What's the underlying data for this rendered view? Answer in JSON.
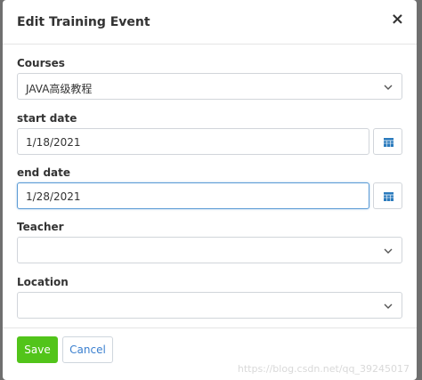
{
  "dialog": {
    "title": "Edit Training Event",
    "close_glyph": "×"
  },
  "fields": {
    "courses": {
      "label": "Courses",
      "value": "JAVA高级教程"
    },
    "start_date": {
      "label": "start date",
      "value": "1/18/2021"
    },
    "end_date": {
      "label": "end date",
      "value": "1/28/2021"
    },
    "teacher": {
      "label": "Teacher",
      "value": ""
    },
    "location": {
      "label": "Location",
      "value": ""
    }
  },
  "buttons": {
    "save": "Save",
    "cancel": "Cancel"
  },
  "watermark": "https://blog.csdn.net/qq_39245017",
  "icons": {
    "calendar": "calendar-icon",
    "chevron": "chevron-down-icon",
    "close": "close-icon"
  },
  "colors": {
    "save_bg": "#52c41a",
    "link": "#3a7fcf",
    "calendar": "#2b7bbd",
    "focus_border": "#5b9bd5"
  }
}
